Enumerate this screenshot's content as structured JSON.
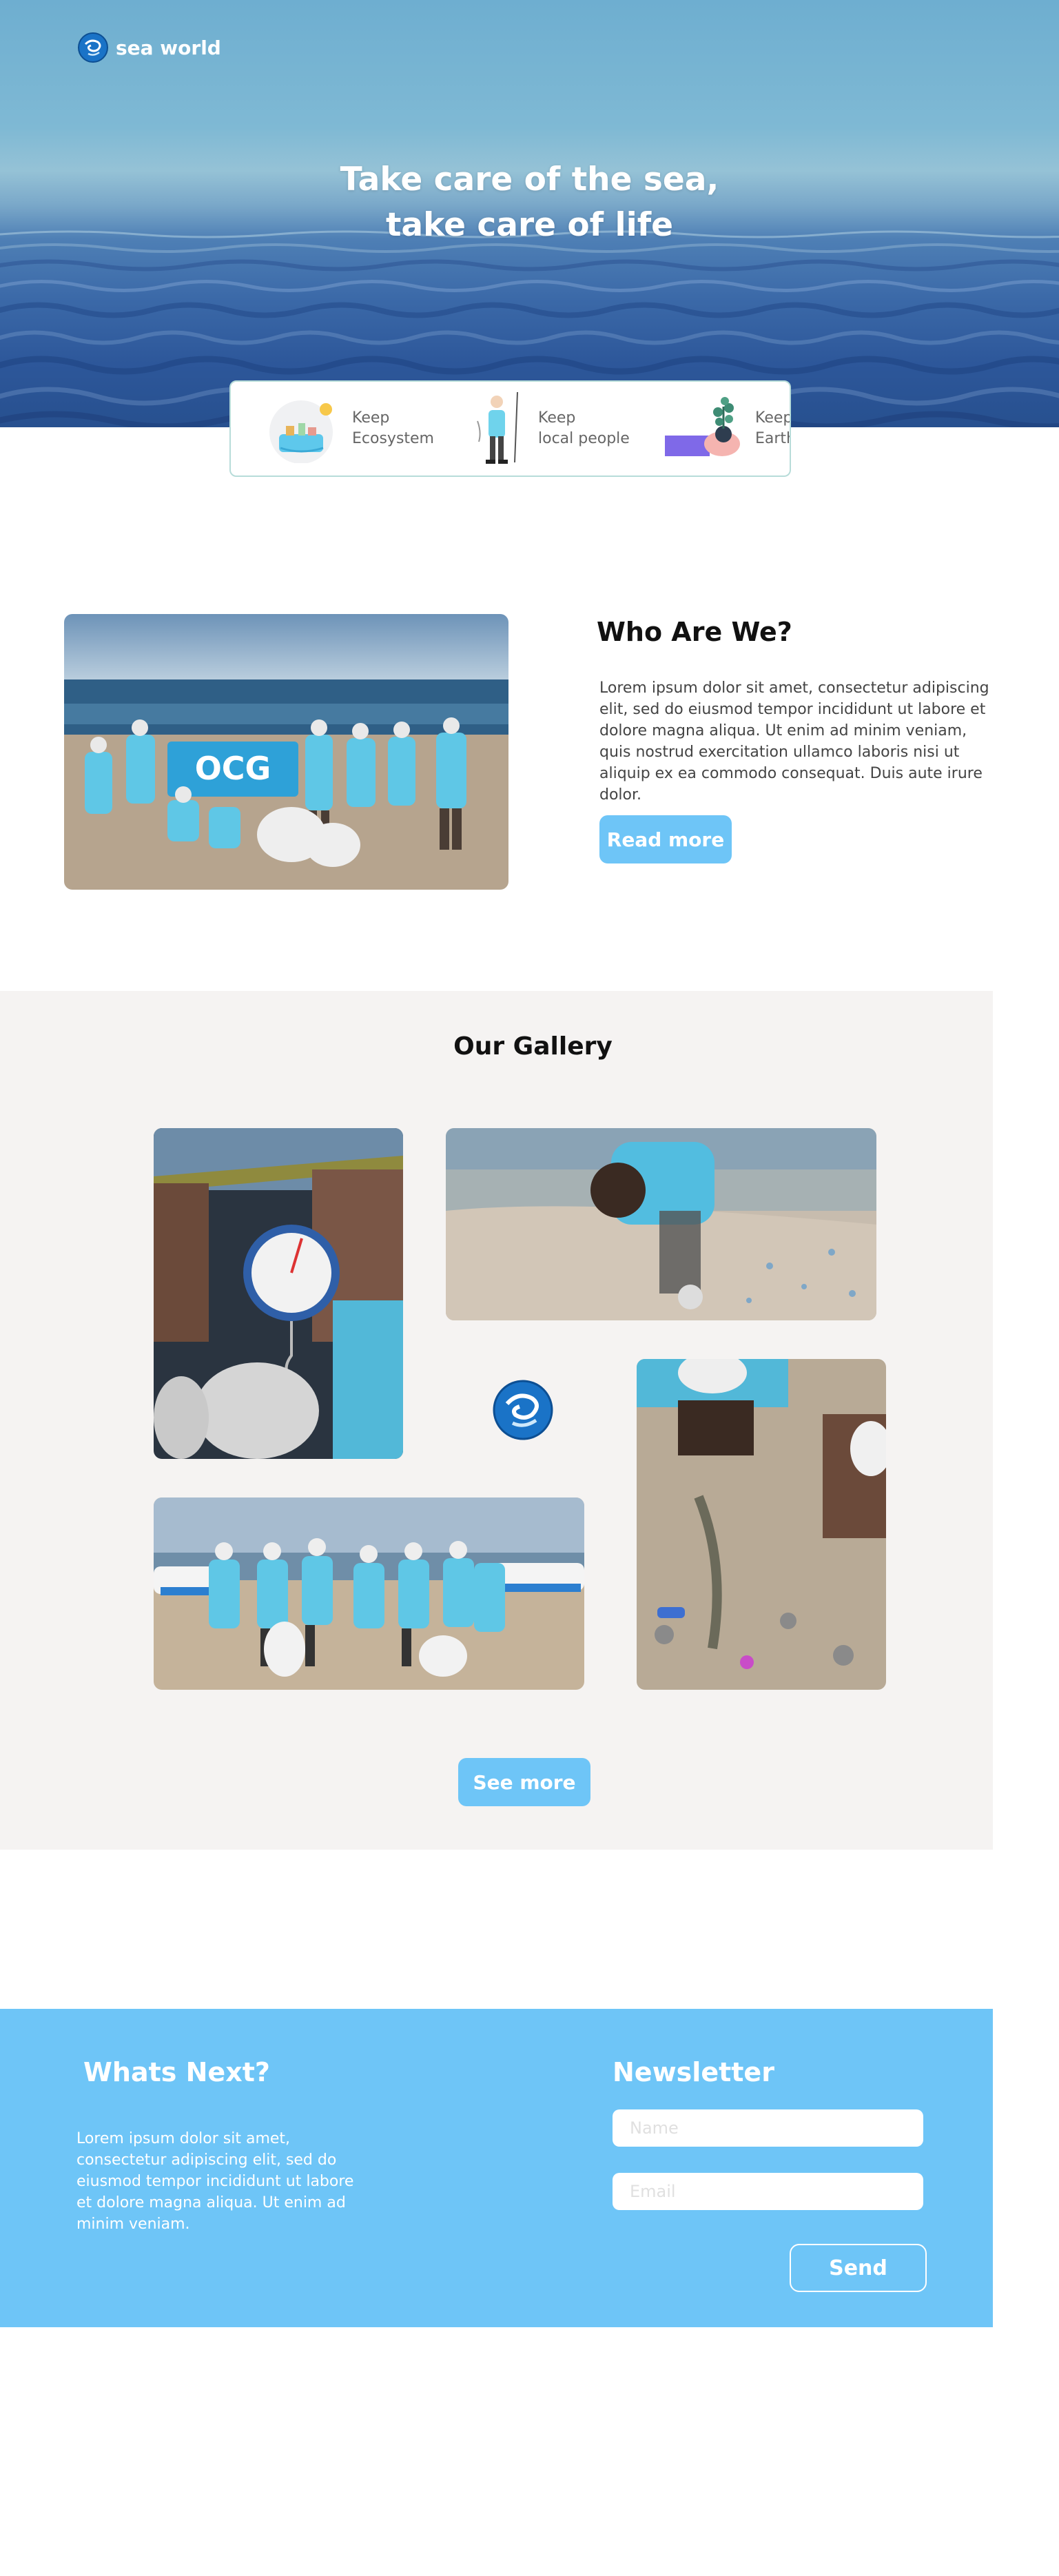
{
  "header": {
    "logo_text": "sea world",
    "logo_icon": "globe-swirl-icon"
  },
  "hero": {
    "title_line1": "Take care of the sea,",
    "title_line2": "take care of life"
  },
  "features": [
    {
      "label": "Keep\nEcosystem",
      "icon": "ecosystem-illustration"
    },
    {
      "label": "Keep\nlocal people",
      "icon": "fisherman-illustration"
    },
    {
      "label": "Keep\nEarth",
      "icon": "plant-in-hand-illustration"
    }
  ],
  "who": {
    "title": "Who Are We?",
    "text": "Lorem ipsum dolor sit amet, consectetur adipiscing elit, sed do eiusmod tempor incididunt ut labore et dolore magna aliqua. Ut enim ad minim veniam, quis nostrud exercitation ullamco laboris nisi ut aliquip ex ea commodo consequat. Duis aute irure dolor.",
    "button_label": "Read more",
    "banner_text": "OCG"
  },
  "gallery": {
    "title": "Our Gallery",
    "button_label": "See more"
  },
  "footer": {
    "whats_next_title": "Whats Next?",
    "whats_next_text": "Lorem ipsum dolor sit amet, consectetur adipiscing elit, sed do eiusmod tempor incididunt ut labore et dolore magna aliqua. Ut enim ad minim veniam.",
    "newsletter_title": "Newsletter",
    "name_placeholder": "Name",
    "email_placeholder": "Email",
    "send_label": "Send"
  },
  "colors": {
    "accent": "#6ec5f7",
    "gallery_bg": "#f5f3f2",
    "card_border": "#b7dcd9"
  }
}
